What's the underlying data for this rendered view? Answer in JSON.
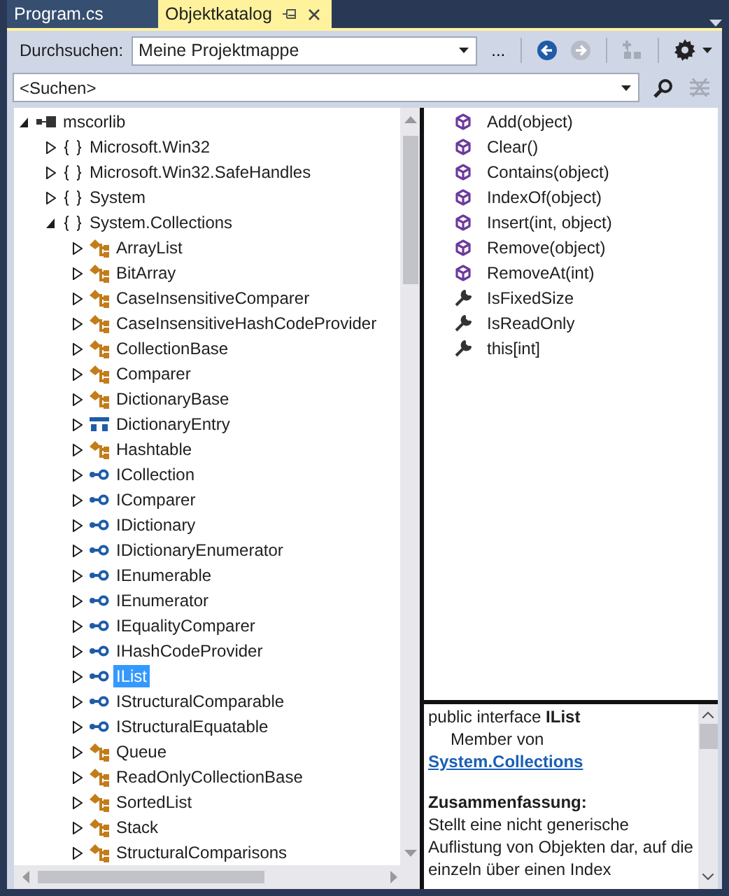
{
  "tabs": [
    {
      "label": "Program.cs",
      "selected": false
    },
    {
      "label": "Objektkatalog",
      "selected": true
    }
  ],
  "toolbar": {
    "browse_label": "Durchsuchen:",
    "browse_value": "Meine Projektmappe",
    "more": "...",
    "back_disabled": false,
    "forward_disabled": true,
    "hierarchy_disabled": true
  },
  "search": {
    "value": "<Suchen>"
  },
  "tree": [
    {
      "label": "mscorlib",
      "kind": "assembly",
      "expanded": true,
      "children": [
        {
          "label": "Microsoft.Win32",
          "kind": "namespace",
          "expanded": false,
          "selected": false
        },
        {
          "label": "Microsoft.Win32.SafeHandles",
          "kind": "namespace",
          "expanded": false,
          "selected": false
        },
        {
          "label": "System",
          "kind": "namespace",
          "expanded": false,
          "selected": false
        },
        {
          "label": "System.Collections",
          "kind": "namespace",
          "expanded": true,
          "selected": false,
          "children": [
            {
              "label": "ArrayList",
              "kind": "class",
              "expanded": false,
              "selected": false
            },
            {
              "label": "BitArray",
              "kind": "class",
              "expanded": false,
              "selected": false
            },
            {
              "label": "CaseInsensitiveComparer",
              "kind": "class",
              "expanded": false,
              "selected": false
            },
            {
              "label": "CaseInsensitiveHashCodeProvider",
              "kind": "class",
              "expanded": false,
              "selected": false
            },
            {
              "label": "CollectionBase",
              "kind": "class",
              "expanded": false,
              "selected": false
            },
            {
              "label": "Comparer",
              "kind": "class",
              "expanded": false,
              "selected": false
            },
            {
              "label": "DictionaryBase",
              "kind": "class",
              "expanded": false,
              "selected": false
            },
            {
              "label": "DictionaryEntry",
              "kind": "struct",
              "expanded": false,
              "selected": false
            },
            {
              "label": "Hashtable",
              "kind": "class",
              "expanded": false,
              "selected": false
            },
            {
              "label": "ICollection",
              "kind": "interface",
              "expanded": false,
              "selected": false
            },
            {
              "label": "IComparer",
              "kind": "interface",
              "expanded": false,
              "selected": false
            },
            {
              "label": "IDictionary",
              "kind": "interface",
              "expanded": false,
              "selected": false
            },
            {
              "label": "IDictionaryEnumerator",
              "kind": "interface",
              "expanded": false,
              "selected": false
            },
            {
              "label": "IEnumerable",
              "kind": "interface",
              "expanded": false,
              "selected": false
            },
            {
              "label": "IEnumerator",
              "kind": "interface",
              "expanded": false,
              "selected": false
            },
            {
              "label": "IEqualityComparer",
              "kind": "interface",
              "expanded": false,
              "selected": false
            },
            {
              "label": "IHashCodeProvider",
              "kind": "interface",
              "expanded": false,
              "selected": false
            },
            {
              "label": "IList",
              "kind": "interface",
              "expanded": false,
              "selected": true
            },
            {
              "label": "IStructuralComparable",
              "kind": "interface",
              "expanded": false,
              "selected": false
            },
            {
              "label": "IStructuralEquatable",
              "kind": "interface",
              "expanded": false,
              "selected": false
            },
            {
              "label": "Queue",
              "kind": "class",
              "expanded": false,
              "selected": false
            },
            {
              "label": "ReadOnlyCollectionBase",
              "kind": "class",
              "expanded": false,
              "selected": false
            },
            {
              "label": "SortedList",
              "kind": "class",
              "expanded": false,
              "selected": false
            },
            {
              "label": "Stack",
              "kind": "class",
              "expanded": false,
              "selected": false
            },
            {
              "label": "StructuralComparisons",
              "kind": "class",
              "expanded": false,
              "selected": false
            }
          ]
        }
      ],
      "selected": false
    }
  ],
  "members": [
    {
      "label": "Add(object)",
      "kind": "method"
    },
    {
      "label": "Clear()",
      "kind": "method"
    },
    {
      "label": "Contains(object)",
      "kind": "method"
    },
    {
      "label": "IndexOf(object)",
      "kind": "method"
    },
    {
      "label": "Insert(int, object)",
      "kind": "method"
    },
    {
      "label": "Remove(object)",
      "kind": "method"
    },
    {
      "label": "RemoveAt(int)",
      "kind": "method"
    },
    {
      "label": "IsFixedSize",
      "kind": "property"
    },
    {
      "label": "IsReadOnly",
      "kind": "property"
    },
    {
      "label": "this[int]",
      "kind": "property"
    }
  ],
  "details": {
    "signature": "public interface **IList**",
    "member_of": "Member von",
    "link": "System.Collections",
    "summary_heading": "Zusammenfassung:",
    "summary": "Stellt eine nicht generische Auflistung von Objekten dar, auf die einzeln über einen Index"
  }
}
